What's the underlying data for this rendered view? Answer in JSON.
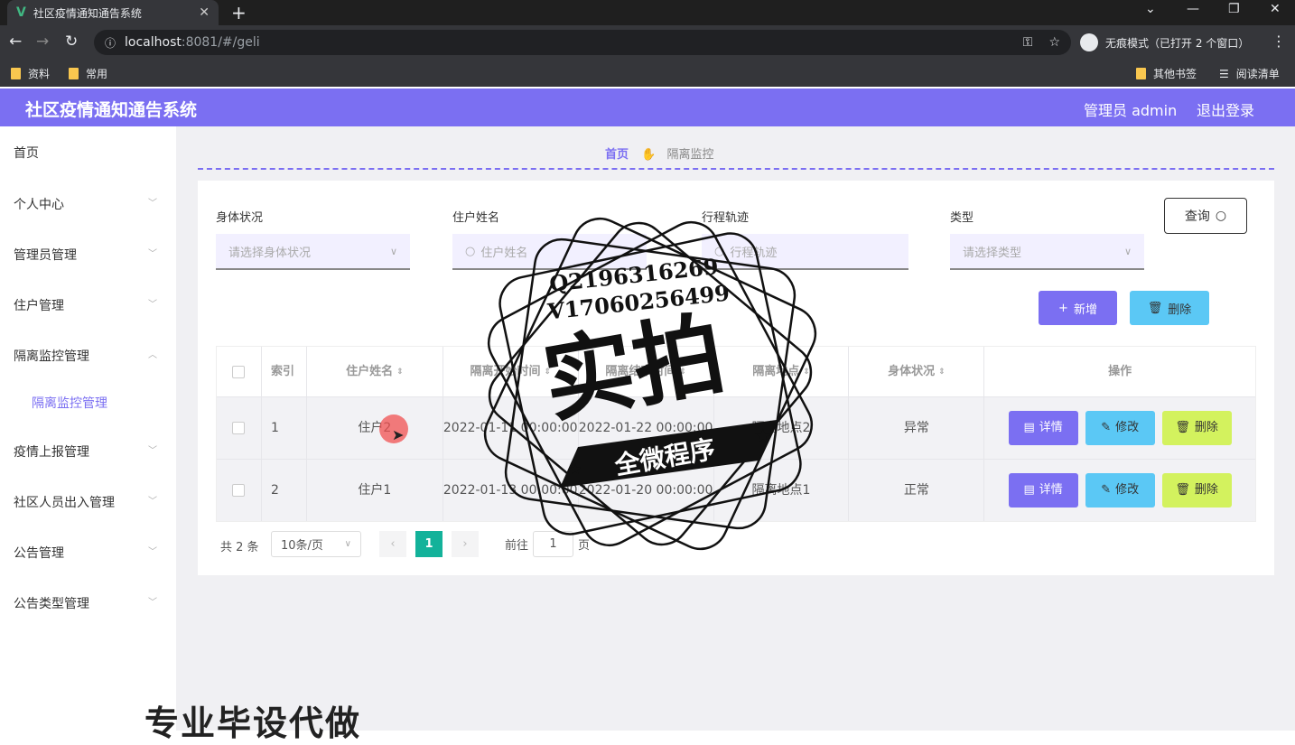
{
  "browser": {
    "tab_title": "社区疫情通知通告系统",
    "url_host": "localhost",
    "url_rest": ":8081/#/geli",
    "incognito_label": "无痕模式（已打开 2 个窗口）",
    "bookmarks": [
      "资料",
      "常用"
    ],
    "other_bookmarks": "其他书签",
    "reading_list": "阅读清单"
  },
  "header": {
    "title": "社区疫情通知通告系统",
    "admin": "管理员 admin",
    "logout": "退出登录"
  },
  "sidebar": {
    "items": [
      "首页",
      "个人中心",
      "管理员管理",
      "住户管理",
      "隔离监控管理",
      "疫情上报管理",
      "社区人员出入管理",
      "公告管理",
      "公告类型管理"
    ],
    "active_sub": "隔离监控管理"
  },
  "breadcrumb": {
    "home": "首页",
    "current": "隔离监控"
  },
  "filters": [
    {
      "label": "身体状况",
      "placeholder": "请选择身体状况"
    },
    {
      "label": "住户姓名",
      "placeholder": "住户姓名"
    },
    {
      "label": "行程轨迹",
      "placeholder": "行程轨迹"
    },
    {
      "label": "类型",
      "placeholder": "请选择类型"
    }
  ],
  "buttons": {
    "query": "查询",
    "add": "新增",
    "delete": "删除"
  },
  "table": {
    "headers": [
      "索引",
      "住户姓名",
      "隔离开始时间",
      "隔离结束时间",
      "隔离地点",
      "身体状况",
      "操作"
    ],
    "rows": [
      {
        "index": "1",
        "name": "住户2",
        "start": "2022-01-11 00:00:00",
        "end": "2022-01-22 00:00:00",
        "place": "隔离地点2",
        "status": "异常"
      },
      {
        "index": "2",
        "name": "住户1",
        "start": "2022-01-13 00:00:00",
        "end": "2022-01-20 00:00:00",
        "place": "隔离地点1",
        "status": "正常"
      }
    ],
    "actions": {
      "detail": "详情",
      "edit": "修改",
      "remove": "删除"
    }
  },
  "pagination": {
    "total": "共 2 条",
    "page_size": "10条/页",
    "current": "1",
    "goto_prefix": "前往",
    "goto_value": "1",
    "goto_suffix": "页"
  },
  "watermark": {
    "line1": "Q2196316269",
    "line2": "V17060256499",
    "big": "实拍",
    "banner": "全微程序"
  },
  "bottom_text": "专业毕设代做"
}
